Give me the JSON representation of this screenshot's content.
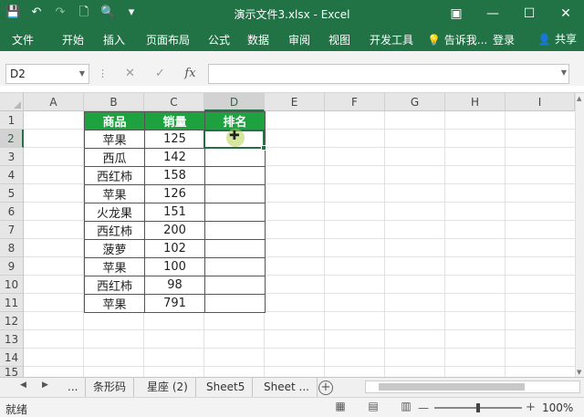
{
  "titlebar": {
    "title": "演示文件3.xlsx - Excel",
    "qat_icons": [
      "save-icon",
      "undo-icon",
      "redo-icon",
      "new-file-icon",
      "print-preview-icon",
      "customize-qat-icon"
    ],
    "ribbon_options_icon": "ribbon-display-icon"
  },
  "ribbon": {
    "tabs": [
      "文件",
      "开始",
      "插入",
      "页面布局",
      "公式",
      "数据",
      "审阅",
      "视图",
      "开发工具"
    ],
    "tell_me": "告诉我...",
    "login": "登录",
    "share": "共享"
  },
  "formula_bar": {
    "name_box": "D2",
    "formula": "",
    "fx_label": "fx"
  },
  "grid": {
    "columns": [
      "A",
      "B",
      "C",
      "D",
      "E",
      "F",
      "G",
      "H",
      "I"
    ],
    "rows": [
      "1",
      "2",
      "3",
      "4",
      "5",
      "6",
      "7",
      "8",
      "9",
      "10",
      "11",
      "12",
      "13",
      "14",
      "15"
    ],
    "selected_column": "D",
    "selected_row": "2"
  },
  "table": {
    "headers": [
      "商品",
      "销量",
      "排名"
    ],
    "rows": [
      [
        "苹果",
        "125",
        ""
      ],
      [
        "西瓜",
        "142",
        ""
      ],
      [
        "西红柿",
        "158",
        ""
      ],
      [
        "苹果",
        "126",
        ""
      ],
      [
        "火龙果",
        "151",
        ""
      ],
      [
        "西红柿",
        "200",
        ""
      ],
      [
        "菠萝",
        "102",
        ""
      ],
      [
        "苹果",
        "100",
        ""
      ],
      [
        "西红柿",
        "98",
        ""
      ],
      [
        "苹果",
        "791",
        ""
      ]
    ],
    "header_color": "#1ea13f"
  },
  "sheets": {
    "overflow": "...",
    "tabs": [
      "条形码",
      "星座 (2)",
      "Sheet5",
      "Sheet ..."
    ]
  },
  "status": {
    "ready": "就绪",
    "zoom": "100%",
    "zoom_level": 100
  },
  "colors": {
    "accent": "#217346"
  }
}
